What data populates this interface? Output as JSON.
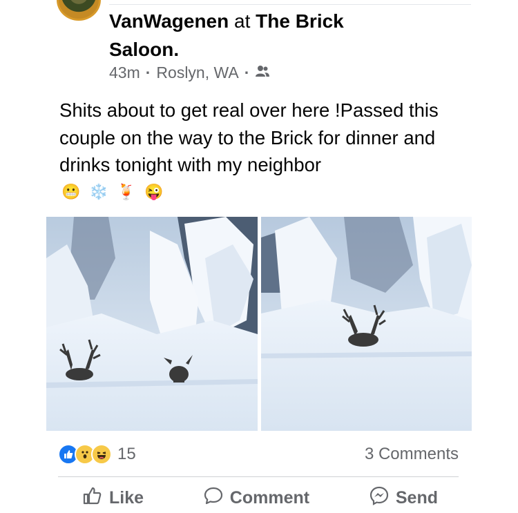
{
  "post": {
    "author": "VanWagenen",
    "at_word": "at",
    "place": "The Brick",
    "place_suffix": "Saloon.",
    "time": "43m",
    "location": "Roslyn, WA",
    "audience_icon": "friends-icon",
    "text": "Shits about to get real over here !Passed this couple on the way to the Brick for dinner and drinks tonight with my neighbor",
    "emojis": [
      "😬",
      "❄️",
      "🍹",
      "😜"
    ]
  },
  "stats": {
    "reaction_icons": [
      "like-icon",
      "wow-icon",
      "haha-icon"
    ],
    "reaction_count": "15",
    "comments": "3 Comments"
  },
  "actions": {
    "like": "Like",
    "comment": "Comment",
    "send": "Send"
  },
  "colors": {
    "like_blue": "#1877f2",
    "reaction_yellow": "#f7c948",
    "secondary_text": "#65676b"
  }
}
